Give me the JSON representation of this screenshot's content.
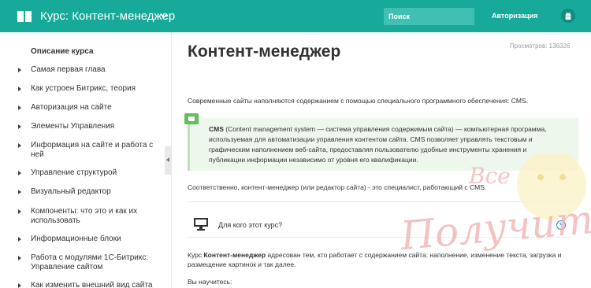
{
  "header": {
    "course_title": "Курс: Контент-менеджер",
    "search_placeholder": "Поиск",
    "auth_label": "Авторизация"
  },
  "sidebar": {
    "items": [
      {
        "label": "Описание курса",
        "active": true
      },
      {
        "label": "Самая первая глава"
      },
      {
        "label": "Как устроен Битрикс, теория"
      },
      {
        "label": "Авторизация на сайте"
      },
      {
        "label": "Элементы Управления"
      },
      {
        "label": "Информация на сайте и работа с ней"
      },
      {
        "label": "Управление структурой"
      },
      {
        "label": "Визуальный редактор"
      },
      {
        "label": "Компоненты: что это и как их использовать"
      },
      {
        "label": "Информационные блоки"
      },
      {
        "label": "Работа с модулями 1С-Битрикс: Управление сайтом"
      },
      {
        "label": "Как изменить внешний вид сайта"
      }
    ]
  },
  "main": {
    "title": "Контент-менеджер",
    "views_label": "Просмотров: 136326",
    "intro": "Современные сайты наполняются содержанием с помощью специального программного обеспечения: CMS.",
    "callout_term": "CMS",
    "callout_text": " (Content management system — система управления содержимым сайта) — компьютерная программа, используемая для автоматизации управления контентом сайта. CMS позволяет управлять текстовым и графическим наполнением веб-сайта, предоставляя пользователю удобные инструменты хранения и публикации информации независимо от уровня его квалификации.",
    "para2": "Соответственно, контент-менеджер (или редактор сайта) - это специалист, работающий с CMS.",
    "course_box_label": "Для кого этот курс?",
    "para3_prefix": "Курс ",
    "para3_bold": "Контент-менеджер",
    "para3_rest": " адресован тем, кто работает с содержанием сайта: наполнение, изменение текста, загрузка и размещение картинок и так далее.",
    "para4": "Вы научитесь:"
  },
  "watermark": {
    "top": "Все",
    "bottom": "Получится!"
  },
  "colors": {
    "header_bg": "#17a99a",
    "callout_bg": "#edf7ec",
    "callout_icon": "#66bb5c"
  },
  "icons": [
    "book-icon",
    "chevron-down-icon",
    "android-icon",
    "chevron-left-icon",
    "comment-icon",
    "monitor-icon",
    "clock-icon"
  ]
}
